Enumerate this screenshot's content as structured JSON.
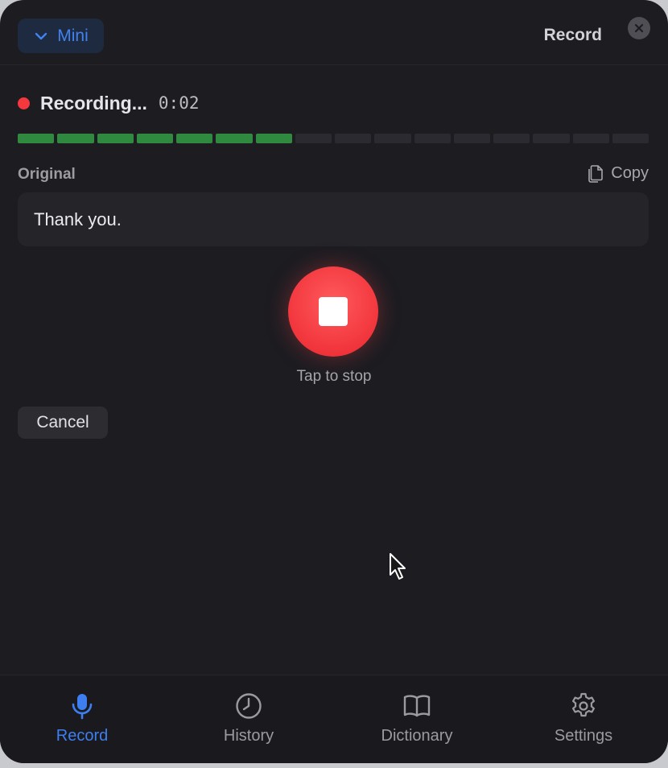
{
  "header": {
    "mini_label": "Mini",
    "title": "Record"
  },
  "status": {
    "label": "Recording...",
    "time": "0:02",
    "level": {
      "active_segments": 7,
      "total_segments": 16
    }
  },
  "transcript": {
    "section_label": "Original",
    "copy_label": "Copy",
    "text": "Thank you."
  },
  "stop": {
    "hint": "Tap to stop"
  },
  "cancel_label": "Cancel",
  "tabs": [
    {
      "label": "Record",
      "icon": "microphone-icon",
      "active": true
    },
    {
      "label": "History",
      "icon": "clock-icon",
      "active": false
    },
    {
      "label": "Dictionary",
      "icon": "book-icon",
      "active": false
    },
    {
      "label": "Settings",
      "icon": "gear-icon",
      "active": false
    }
  ],
  "colors": {
    "accent": "#3d7ff0",
    "recording": "#f5373e",
    "level_on": "#2f8a40",
    "level_off": "#2a2a30"
  }
}
